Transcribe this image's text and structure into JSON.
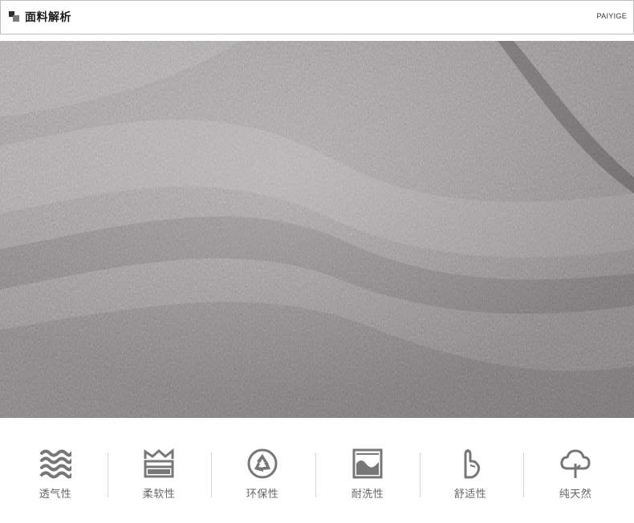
{
  "header": {
    "title": "面料解析",
    "brand": "PAIYIGE"
  },
  "photo": {
    "subject": "gray melange knit fabric close-up",
    "tone": "#9e9a9c"
  },
  "features": {
    "icon_color": "#777777",
    "items": [
      {
        "label": "透气性",
        "icon": "waves-icon"
      },
      {
        "label": "柔软性",
        "icon": "softness-icon"
      },
      {
        "label": "环保性",
        "icon": "recycle-icon"
      },
      {
        "label": "耐洗性",
        "icon": "washable-icon"
      },
      {
        "label": "舒适性",
        "icon": "hand-icon"
      },
      {
        "label": "纯天然",
        "icon": "tree-icon"
      }
    ]
  }
}
